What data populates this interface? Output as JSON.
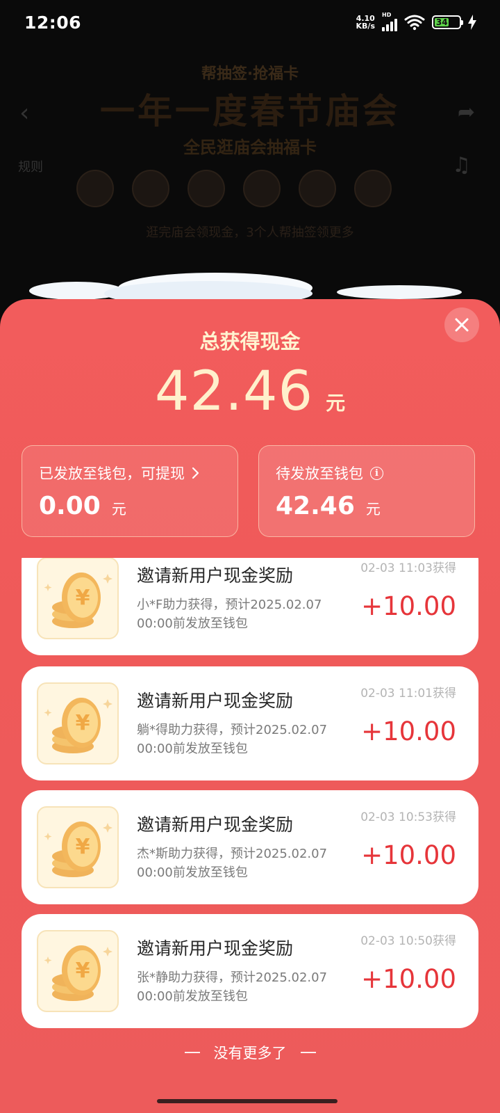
{
  "status_bar": {
    "time": "12:06",
    "net_speed_value": "4.10",
    "net_speed_unit": "KB/s",
    "hd_label": "HD",
    "battery_level": "34",
    "icons": [
      "signal-icon",
      "wifi-icon",
      "battery-icon",
      "charging-icon"
    ]
  },
  "background": {
    "subtitle": "帮抽签·抢福卡",
    "title": "一年一度春节庙会",
    "sub2": "全民逛庙会抽福卡",
    "rules": "规则",
    "note": "逛完庙会领现金，3个人帮抽签领更多"
  },
  "sheet": {
    "title": "总获得现金",
    "total_value": "42.46",
    "total_unit": "元",
    "released": {
      "label": "已发放至钱包，可提现",
      "value": "0.00",
      "unit": "元"
    },
    "pending": {
      "label": "待发放至钱包",
      "value": "42.46",
      "unit": "元"
    }
  },
  "rewards": [
    {
      "title": "邀请新用户现金奖励",
      "time": "02-03 11:03获得",
      "desc": "小*F助力获得，预计2025.02.07 00:00前发放至钱包",
      "amount": "+10.00"
    },
    {
      "title": "邀请新用户现金奖励",
      "time": "02-03 11:01获得",
      "desc": "躺*得助力获得，预计2025.02.07 00:00前发放至钱包",
      "amount": "+10.00"
    },
    {
      "title": "邀请新用户现金奖励",
      "time": "02-03 10:53获得",
      "desc": "杰*斯助力获得，预计2025.02.07 00:00前发放至钱包",
      "amount": "+10.00"
    },
    {
      "title": "邀请新用户现金奖励",
      "time": "02-03 10:50获得",
      "desc": "张*静助力获得，预计2025.02.07 00:00前发放至钱包",
      "amount": "+10.00"
    }
  ],
  "footer": {
    "no_more": "没有更多了"
  },
  "colors": {
    "sheet_red": "#ef5a59",
    "amount_red": "#e6353a",
    "total_cream": "#fff0cc"
  }
}
